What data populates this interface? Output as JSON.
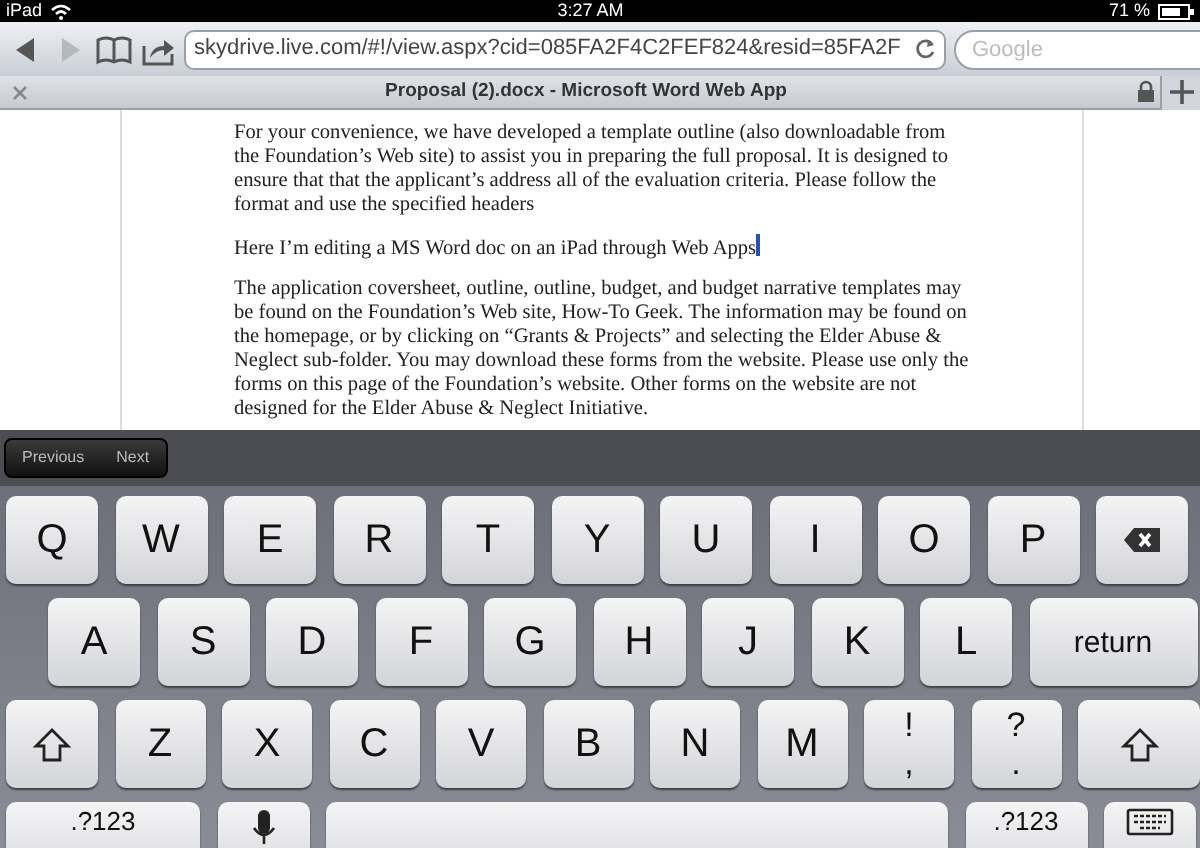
{
  "status_bar": {
    "device": "iPad",
    "time": "3:27 AM",
    "battery": "71 %"
  },
  "toolbar": {
    "buttons": [
      {
        "kind": "back",
        "disabled": false
      },
      {
        "kind": "forward",
        "disabled": true
      },
      {
        "kind": "bookmarks",
        "disabled": false
      },
      {
        "kind": "share",
        "disabled": false
      }
    ],
    "address": {
      "value": "skydrive.live.com/#!/view.aspx?cid=085FA2F4C2FEF824&resid=85FA2F"
    },
    "search": {
      "placeholder": "Google"
    }
  },
  "tab": {
    "title": "Proposal (2).docx - Microsoft Word Web App"
  },
  "document": {
    "paragraphs": [
      {
        "text": "For your convenience, we have developed a template outline (also downloadable from the Foundation’s Web site) to assist you in preparing the full proposal.  It is designed to ensure that that the applicant’s address all of the evaluation criteria.  Please follow the format and use the specified headers",
        "cursor": false
      },
      {
        "text": "Here I’m editing a MS Word doc on an iPad through Web Apps",
        "cursor": true
      },
      {
        "text": "The application coversheet, outline, outline, budget, and budget narrative templates may be found on the Foundation’s Web site, How-To Geek.  The information may be found on the homepage, or by clicking on “Grants & Projects” and selecting the Elder Abuse & Neglect sub-folder.  You may download these forms from the website.  Please use only the forms on this page of the Foundation’s website.  Other forms on the website are not designed for the Elder Abuse & Neglect Initiative.",
        "cursor": false
      }
    ]
  },
  "form_bar": {
    "buttons": [
      "Previous",
      "Next"
    ]
  },
  "keyboard": {
    "rows": [
      {
        "keys": [
          {
            "kind": "letter",
            "label": "Q"
          },
          {
            "kind": "letter",
            "label": "W"
          },
          {
            "kind": "letter",
            "label": "E"
          },
          {
            "kind": "letter",
            "label": "R"
          },
          {
            "kind": "letter",
            "label": "T"
          },
          {
            "kind": "letter",
            "label": "Y"
          },
          {
            "kind": "letter",
            "label": "U"
          },
          {
            "kind": "letter",
            "label": "I"
          },
          {
            "kind": "letter",
            "label": "O"
          },
          {
            "kind": "letter",
            "label": "P"
          },
          {
            "kind": "backspace"
          }
        ]
      },
      {
        "keys": [
          {
            "kind": "letter",
            "label": "A"
          },
          {
            "kind": "letter",
            "label": "S"
          },
          {
            "kind": "letter",
            "label": "D"
          },
          {
            "kind": "letter",
            "label": "F"
          },
          {
            "kind": "letter",
            "label": "G"
          },
          {
            "kind": "letter",
            "label": "H"
          },
          {
            "kind": "letter",
            "label": "J"
          },
          {
            "kind": "letter",
            "label": "K"
          },
          {
            "kind": "letter",
            "label": "L"
          },
          {
            "kind": "return",
            "label": "return"
          }
        ]
      },
      {
        "keys": [
          {
            "kind": "shift"
          },
          {
            "kind": "letter",
            "label": "Z"
          },
          {
            "kind": "letter",
            "label": "X"
          },
          {
            "kind": "letter",
            "label": "C"
          },
          {
            "kind": "letter",
            "label": "V"
          },
          {
            "kind": "letter",
            "label": "B"
          },
          {
            "kind": "letter",
            "label": "N"
          },
          {
            "kind": "letter",
            "label": "M"
          },
          {
            "kind": "dual",
            "top": "!",
            "bottom": ","
          },
          {
            "kind": "dual",
            "top": "?",
            "bottom": "."
          },
          {
            "kind": "shift_wide"
          }
        ]
      },
      {
        "keys": [
          {
            "kind": "numbers",
            "label": ".?123"
          },
          {
            "kind": "mic"
          },
          {
            "kind": "space"
          },
          {
            "kind": "numbers_small",
            "label": ".?123"
          },
          {
            "kind": "hide"
          }
        ]
      }
    ]
  }
}
